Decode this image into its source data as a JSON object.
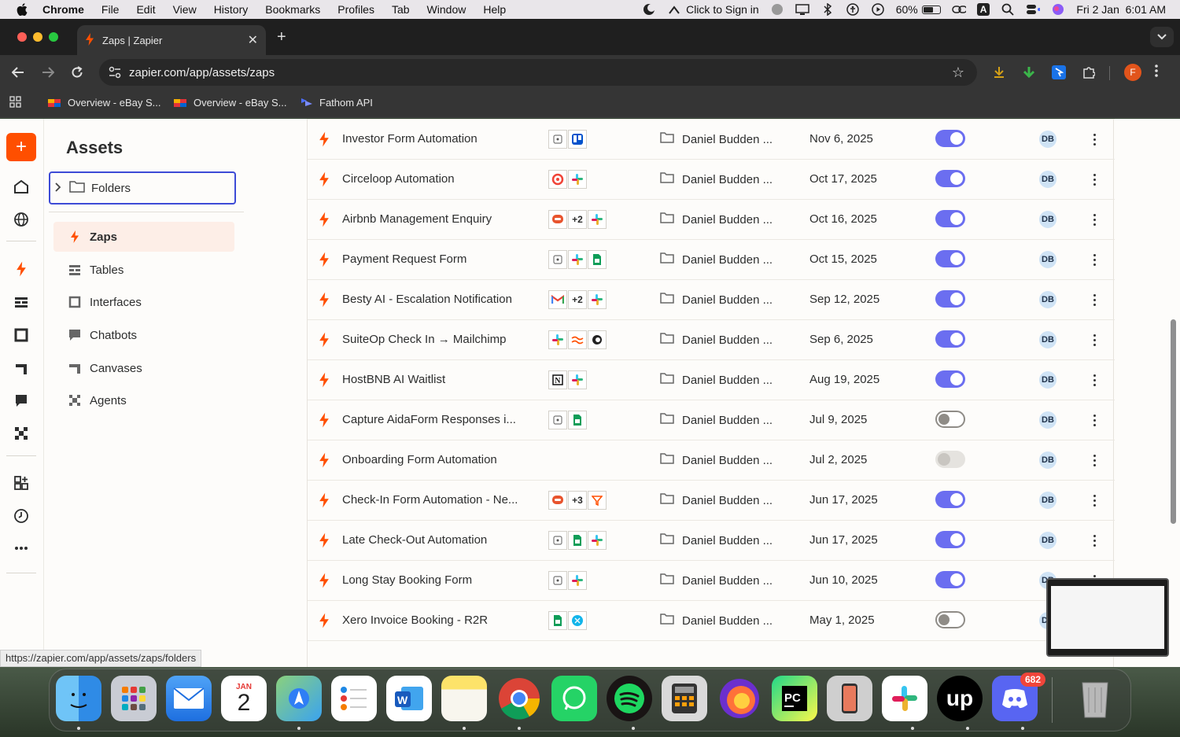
{
  "menubar": {
    "app": "Chrome",
    "items": [
      "File",
      "Edit",
      "View",
      "History",
      "Bookmarks",
      "Profiles",
      "Tab",
      "Window",
      "Help"
    ],
    "sign_in": "Click to Sign in",
    "battery": "60%",
    "input_source": "A",
    "datetime": "Fri 2 Jan  6:01 AM"
  },
  "browser": {
    "tab_title": "Zaps | Zapier",
    "url": "zapier.com/app/assets/zaps",
    "profile_initial": "F",
    "bookmarks": [
      "Overview - eBay S...",
      "Overview - eBay S...",
      "Fathom API"
    ]
  },
  "sidebar": {
    "title": "Assets",
    "folders_label": "Folders",
    "items": [
      {
        "label": "Zaps",
        "icon": "bolt-icon",
        "active": true
      },
      {
        "label": "Tables",
        "icon": "tables-icon"
      },
      {
        "label": "Interfaces",
        "icon": "interfaces-icon"
      },
      {
        "label": "Chatbots",
        "icon": "chatbot-icon"
      },
      {
        "label": "Canvases",
        "icon": "canvas-icon"
      },
      {
        "label": "Agents",
        "icon": "agents-icon"
      }
    ]
  },
  "zaps": [
    {
      "name": "Investor Form Automation",
      "apps": [
        "form",
        "trello"
      ],
      "location": "Daniel Budden ...",
      "date": "Nov 6, 2025",
      "status": "on",
      "owner": "DB"
    },
    {
      "name": "Circeloop Automation",
      "apps": [
        "circleloop",
        "slack"
      ],
      "location": "Daniel Budden ...",
      "date": "Oct 17, 2025",
      "status": "on",
      "owner": "DB"
    },
    {
      "name": "Airbnb Management Enquiry",
      "apps": [
        "chat",
        "+2",
        "slack"
      ],
      "location": "Daniel Budden ...",
      "date": "Oct 16, 2025",
      "status": "on",
      "owner": "DB"
    },
    {
      "name": "Payment Request Form",
      "apps": [
        "form",
        "slack",
        "sheets"
      ],
      "location": "Daniel Budden ...",
      "date": "Oct 15, 2025",
      "status": "on",
      "owner": "DB"
    },
    {
      "name": "Besty AI - Escalation Notification",
      "apps": [
        "gmail",
        "+2",
        "slack"
      ],
      "location": "Daniel Budden ...",
      "date": "Sep 12, 2025",
      "status": "on",
      "owner": "DB"
    },
    {
      "name": "SuiteOp Check In → Mailchimp",
      "apps": [
        "slack",
        "formatter",
        "mailchimp"
      ],
      "location": "Daniel Budden ...",
      "date": "Sep 6, 2025",
      "status": "on",
      "owner": "DB"
    },
    {
      "name": "HostBNB AI Waitlist",
      "apps": [
        "notion",
        "slack"
      ],
      "location": "Daniel Budden ...",
      "date": "Aug 19, 2025",
      "status": "on",
      "owner": "DB"
    },
    {
      "name": "Capture AidaForm Responses i...",
      "apps": [
        "form",
        "sheets"
      ],
      "location": "Daniel Budden ...",
      "date": "Jul 9, 2025",
      "status": "off",
      "owner": "DB"
    },
    {
      "name": "Onboarding Form Automation",
      "apps": [],
      "location": "Daniel Budden ...",
      "date": "Jul 2, 2025",
      "status": "disabled",
      "owner": "DB"
    },
    {
      "name": "Check-In Form Automation - Ne...",
      "apps": [
        "chat",
        "+3",
        "filter"
      ],
      "location": "Daniel Budden ...",
      "date": "Jun 17, 2025",
      "status": "on",
      "owner": "DB"
    },
    {
      "name": "Late Check-Out Automation",
      "apps": [
        "form",
        "sheets",
        "slack"
      ],
      "location": "Daniel Budden ...",
      "date": "Jun 17, 2025",
      "status": "on",
      "owner": "DB"
    },
    {
      "name": "Long Stay Booking Form",
      "apps": [
        "form",
        "slack"
      ],
      "location": "Daniel Budden ...",
      "date": "Jun 10, 2025",
      "status": "on",
      "owner": "DB"
    },
    {
      "name": "Xero Invoice Booking - R2R",
      "apps": [
        "sheets",
        "xero"
      ],
      "location": "Daniel Budden ...",
      "date": "May 1, 2025",
      "status": "off",
      "owner": "DB"
    }
  ],
  "status_bar_url": "https://zapier.com/app/assets/zaps/folders",
  "dock": {
    "calendar_month": "JAN",
    "calendar_day": "2",
    "discord_badge": "682"
  },
  "colors": {
    "zapier_orange": "#ff4f00",
    "toggle_on": "#6b6ef0",
    "focus_border": "#3d4bd6"
  }
}
